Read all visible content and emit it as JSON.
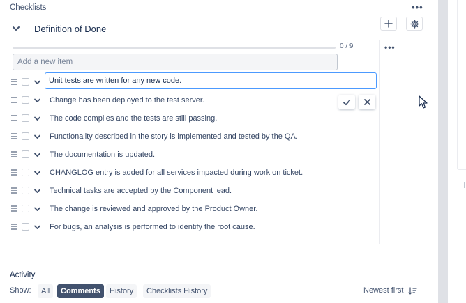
{
  "header": {
    "section_title": "Checklists",
    "checklist_name": "Definition of Done",
    "more_label": "•••",
    "icons": {
      "collapse": "chevron-down-icon",
      "add": "plus-icon",
      "settings": "gear-icon"
    }
  },
  "progress": {
    "label": "0 / 9",
    "done": 0,
    "total": 9
  },
  "new_item": {
    "placeholder": "Add a new item"
  },
  "side_menu": {
    "label": "•••"
  },
  "items": [
    {
      "text": "Unit tests are written for any new code.",
      "editing": true
    },
    {
      "text": "Change has been deployed to the test server."
    },
    {
      "text": "The code compiles and the tests are still passing."
    },
    {
      "text": "Functionality described in the story is implemented and tested by the QA."
    },
    {
      "text": "The documentation is updated."
    },
    {
      "text": "CHANGLOG entry is added for all services impacted during work on ticket."
    },
    {
      "text": "Technical tasks are accepted by the Component lead."
    },
    {
      "text": "The change is reviewed and approved by the Product Owner."
    },
    {
      "text": "For bugs, an analysis is performed to identify the root cause."
    }
  ],
  "edit_actions": {
    "confirm": "check-icon",
    "cancel": "close-icon"
  },
  "activity": {
    "title": "Activity",
    "show_label": "Show:",
    "filters": [
      {
        "label": "All",
        "active": false
      },
      {
        "label": "Comments",
        "active": true
      },
      {
        "label": "History",
        "active": false
      },
      {
        "label": "Checklists History",
        "active": false
      }
    ],
    "sort_label": "Newest first",
    "sort_icon": "sort-descending-icon"
  },
  "colors": {
    "accent": "#4c9aff",
    "progress": "#36b37e",
    "active_filter": "#42526e"
  }
}
